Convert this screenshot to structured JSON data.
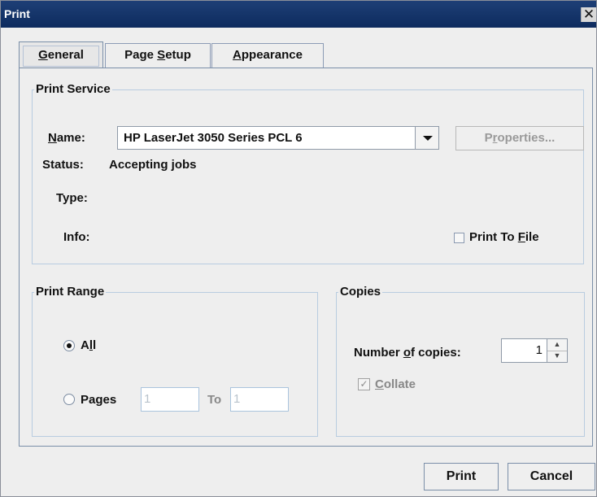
{
  "window": {
    "title": "Print"
  },
  "icons": {
    "close": "close-icon"
  },
  "tabs": [
    {
      "label": "General",
      "mnemonic": "G",
      "selected": true
    },
    {
      "label": "Page Setup",
      "mnemonic": "S",
      "selected": false
    },
    {
      "label": "Appearance",
      "mnemonic": "A",
      "selected": false
    }
  ],
  "print_service": {
    "group_label": "Print Service",
    "name_label": "Name:",
    "printer_name": "HP LaserJet 3050 Series PCL 6",
    "properties_label": "Properties...",
    "status_label": "Status:",
    "status_value": "Accepting jobs",
    "type_label": "Type:",
    "info_label": "Info:",
    "print_to_file_label": "Print To File",
    "print_to_file_checked": false
  },
  "print_range": {
    "group_label": "Print Range",
    "all_label": "All",
    "all_selected": true,
    "pages_label": "Pages",
    "from_value": "1",
    "to_label": "To",
    "to_value": "1"
  },
  "copies": {
    "group_label": "Copies",
    "number_label": "Number of copies:",
    "number_value": "1",
    "collate_label": "Collate",
    "collate_checked": true
  },
  "buttons": {
    "print": "Print",
    "cancel": "Cancel"
  }
}
